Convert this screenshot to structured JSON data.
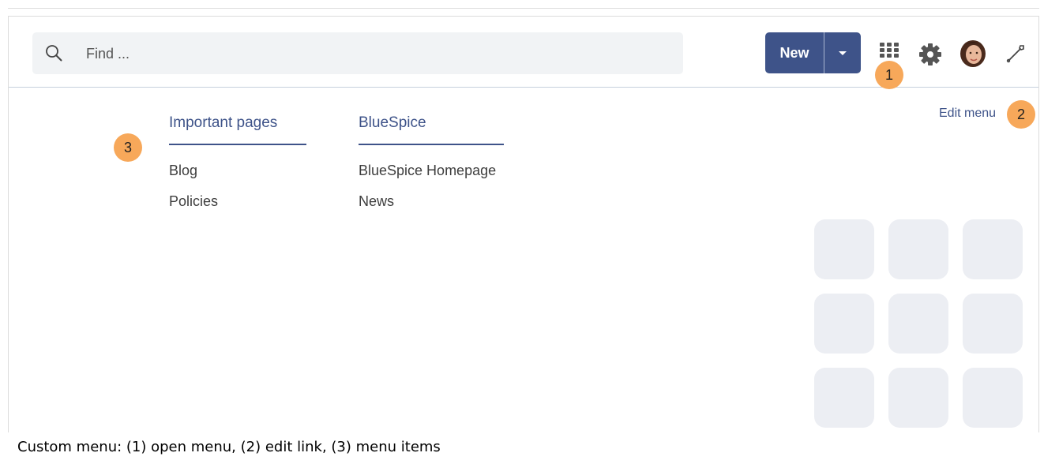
{
  "search": {
    "placeholder": "Find ..."
  },
  "toolbar": {
    "new_label": "New",
    "icons": [
      "search-icon",
      "apps-grid-icon",
      "gear-icon",
      "avatar",
      "wrench-icon"
    ]
  },
  "badges": {
    "one": "1",
    "two": "2",
    "three": "3"
  },
  "menu": {
    "edit_label": "Edit menu",
    "columns": [
      {
        "heading": "Important pages",
        "items": [
          "Blog",
          "Policies"
        ]
      },
      {
        "heading": "BlueSpice",
        "items": [
          "BlueSpice Homepage",
          "News"
        ]
      }
    ]
  },
  "caption": "Custom menu: (1) open menu, (2) edit link, (3) menu items",
  "colors": {
    "accent": "#3e5389",
    "badge": "#f7a85a",
    "search_bg": "#f1f3f5",
    "tile_bg": "#eceef3"
  }
}
